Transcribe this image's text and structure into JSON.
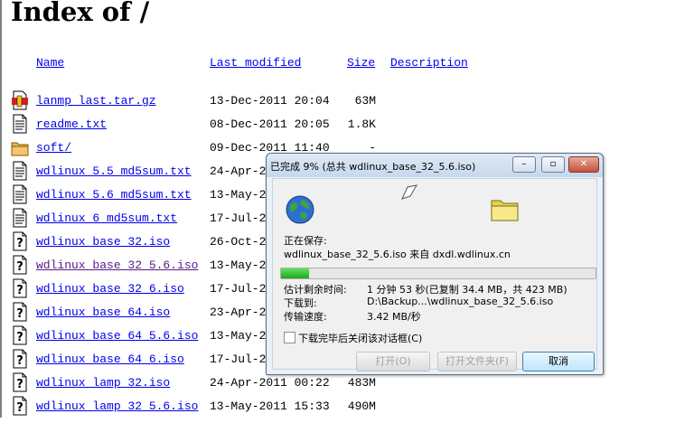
{
  "page": {
    "title": "Index of /",
    "columns": {
      "name": "Name",
      "last_modified": "Last modified",
      "size": "Size",
      "description": "Description"
    },
    "rows": [
      {
        "icon": "archive-icon",
        "name": "lanmp_last.tar.gz",
        "date": "13-Dec-2011 20:04",
        "size": "63M"
      },
      {
        "icon": "text-file-icon",
        "name": "readme.txt",
        "date": "08-Dec-2011 20:05",
        "size": "1.8K"
      },
      {
        "icon": "folder-icon",
        "name": "soft/",
        "date": "09-Dec-2011 11:40",
        "size": "-"
      },
      {
        "icon": "text-file-icon",
        "name": "wdlinux_5.5_md5sum.txt",
        "date": "24-Apr-2",
        "size": ""
      },
      {
        "icon": "text-file-icon",
        "name": "wdlinux_5.6_md5sum.txt",
        "date": "13-May-2",
        "size": ""
      },
      {
        "icon": "text-file-icon",
        "name": "wdlinux_6_md5sum.txt",
        "date": "17-Jul-2",
        "size": ""
      },
      {
        "icon": "unknown-file-icon",
        "name": "wdlinux_base_32.iso",
        "date": "26-Oct-2",
        "size": ""
      },
      {
        "icon": "unknown-file-icon",
        "name": "wdlinux_base_32_5.6.iso",
        "date": "13-May-2",
        "size": ""
      },
      {
        "icon": "unknown-file-icon",
        "name": "wdlinux_base_32_6.iso",
        "date": "17-Jul-2",
        "size": ""
      },
      {
        "icon": "unknown-file-icon",
        "name": "wdlinux_base_64.iso",
        "date": "23-Apr-2",
        "size": ""
      },
      {
        "icon": "unknown-file-icon",
        "name": "wdlinux_base_64_5.6.iso",
        "date": "13-May-2",
        "size": ""
      },
      {
        "icon": "unknown-file-icon",
        "name": "wdlinux_base_64_6.iso",
        "date": "17-Jul-2",
        "size": ""
      },
      {
        "icon": "unknown-file-icon",
        "name": "wdlinux_lamp_32.iso",
        "date": "24-Apr-2011 00:22",
        "size": "483M"
      },
      {
        "icon": "unknown-file-icon",
        "name": "wdlinux_lamp_32_5.6.iso",
        "date": "13-May-2011 15:33",
        "size": "490M"
      }
    ]
  },
  "dialog": {
    "title": "已完成 9% (总共 wdlinux_base_32_5.6.iso)",
    "saving_label": "正在保存:",
    "source_line": "wdlinux_base_32_5.6.iso 来自 dxdl.wdlinux.cn",
    "progress": 0.09,
    "remaining_label": "估计剩余时间:",
    "remaining_value": "1 分钟 53 秒(已复制 34.4 MB，共 423 MB)",
    "download_to_label": "下载到:",
    "download_to_value": "D:\\Backup...\\wdlinux_base_32_5.6.iso",
    "speed_label": "传输速度:",
    "speed_value": "3.42 MB/秒",
    "close_on_complete": "下载完毕后关闭该对话框(C)",
    "buttons": {
      "open": "打开(O)",
      "open_folder": "打开文件夹(F)",
      "cancel": "取消"
    }
  }
}
